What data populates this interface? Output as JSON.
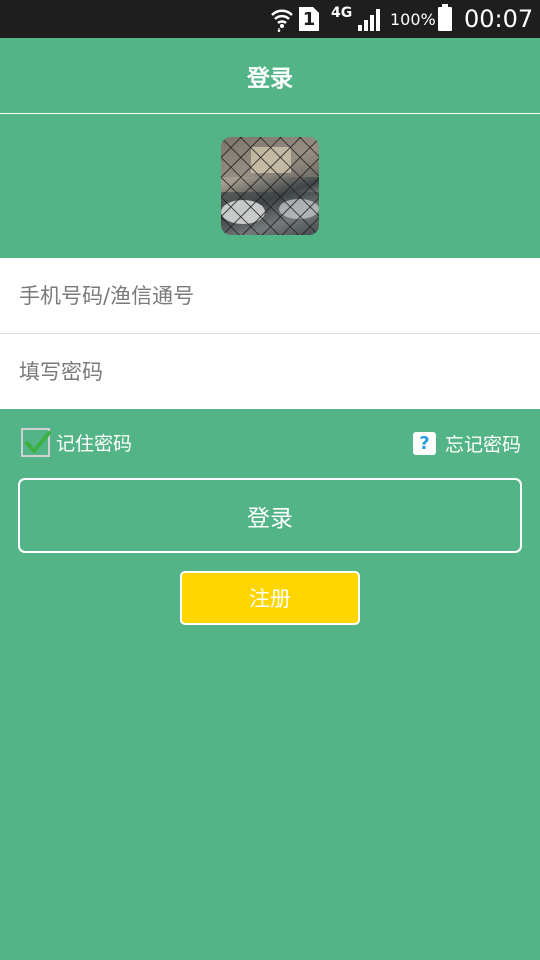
{
  "status_bar": {
    "sim_slot": "1",
    "network": "4G",
    "battery": "100%",
    "time": "00:07",
    "icons": [
      "wifi-icon",
      "sim-icon",
      "signal-icon",
      "battery-icon"
    ]
  },
  "header": {
    "title": "登录"
  },
  "form": {
    "account_placeholder": "手机号码/渔信通号",
    "password_placeholder": "填写密码"
  },
  "options": {
    "remember_label": "记住密码",
    "remember_checked": true,
    "forgot_label": "忘记密码",
    "help_glyph": "?"
  },
  "buttons": {
    "login_label": "登录",
    "register_label": "注册"
  },
  "colors": {
    "background": "#52b487",
    "register_button": "#ffd500",
    "checkmark": "#3cb043"
  }
}
